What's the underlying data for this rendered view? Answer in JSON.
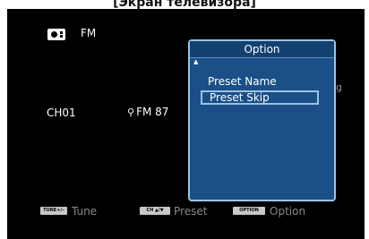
{
  "caption": "[Экран телевизора]",
  "source": {
    "label": "FM",
    "icon": "radio-icon"
  },
  "channel": "CH01",
  "station": {
    "icon": "antenna-icon",
    "label": "FM 87"
  },
  "status_fragment": "ng",
  "popup": {
    "title": "Option",
    "items": [
      {
        "label": "Preset Name",
        "selected": false
      },
      {
        "label": "Preset Skip",
        "selected": true
      }
    ]
  },
  "hints": [
    {
      "badge": "TUNE+/–",
      "label": "Tune"
    },
    {
      "badge": "CH ▲/▼",
      "label": "Preset"
    },
    {
      "badge": "OPTION",
      "label": "Option"
    }
  ],
  "colors": {
    "screen_bg": "#000000",
    "popup_bg": "#1a4f87",
    "popup_border": "#9cc2e6",
    "hint_text": "#8a8a8a"
  }
}
